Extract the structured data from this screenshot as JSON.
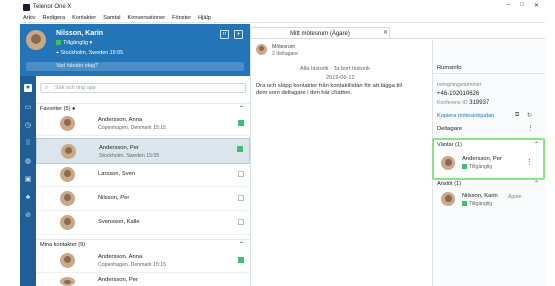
{
  "window": {
    "title": "Telenor One X",
    "min_icon": "minimize-icon",
    "max_icon": "maximize-icon",
    "close_icon": "close-icon"
  },
  "menu": [
    "Arkiv",
    "Redigera",
    "Kontakter",
    "Samtal",
    "Konversationer",
    "Fönster",
    "Hjälp"
  ],
  "profile": {
    "name": "Nilsson, Karin",
    "presence": "Tillgänglig",
    "location": "Stockholm, Sweden  15:05",
    "status_placeholder": "Vad händer idag?"
  },
  "contacts": {
    "search_placeholder": "Sök och ring upp",
    "favorites_header": "Favoriter (5)",
    "favorites": [
      {
        "name": "Andersson, Anna",
        "sub": "Copenhagen, Denmark  15:15",
        "online": true,
        "selected": false
      },
      {
        "name": "Andersson, Per",
        "sub": "Stockholm, Sweden  15:05",
        "online": true,
        "selected": true
      },
      {
        "name": "Larsson, Sven",
        "sub": "",
        "online": false,
        "selected": false
      },
      {
        "name": "Nilsson, Per",
        "sub": "",
        "online": false,
        "selected": false
      },
      {
        "name": "Svensson, Kalle",
        "sub": "",
        "online": false,
        "selected": false
      }
    ],
    "my_contacts_header": "Mina kontakter (9)",
    "my_contacts": [
      {
        "name": "Andersson, Anna",
        "sub": "Copenhagen, Denmark  15:15",
        "online": true
      },
      {
        "name": "Andersson, Per",
        "sub": "",
        "online": true
      }
    ]
  },
  "chat": {
    "tab_label": "Mitt mötesrum (Ägare)",
    "room_name": "Mötesrum",
    "room_participants": "2 deltagare",
    "link_all": "Alla historik",
    "link_short": "Ta bort historik",
    "date": "2019-06-12",
    "message": "Dra och släpp kontakter från kontaktlistan för att lägga till dem som deltagare i den här chatten."
  },
  "roominfo": {
    "title": "Rumsinfo",
    "dialin_label": "Inringningsnummer",
    "dialin_value": "+46-102010626",
    "conf_label": "Konferens-ID",
    "conf_value": "319937",
    "copy_link": "Kopiera mötesinbjudan",
    "participants_title": "Deltagare",
    "waiting_header": "Väntar (1)",
    "waiting": {
      "name": "Andersson, Per",
      "status": "Tillgänglig"
    },
    "connected_header": "Anslöt (1)",
    "connected": {
      "name": "Nilsson, Karin",
      "role": "Ägare",
      "status": "Tillgänglig"
    }
  }
}
